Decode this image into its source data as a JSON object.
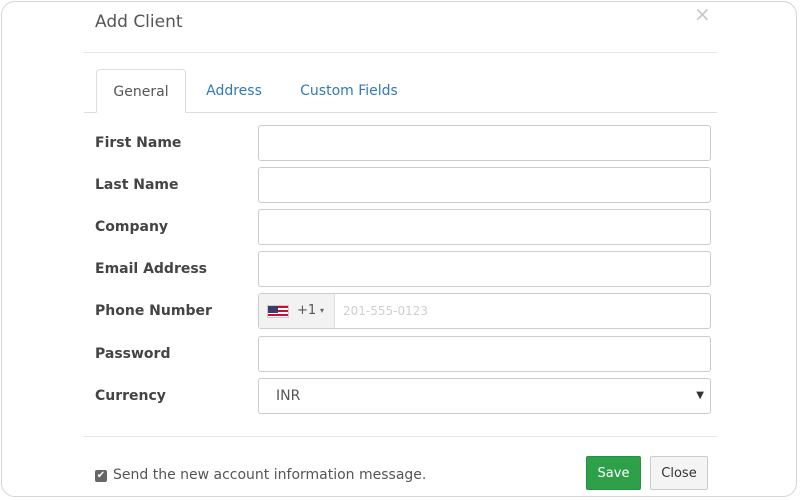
{
  "dialog": {
    "title": "Add Client",
    "close_icon": "×"
  },
  "tabs": [
    {
      "label": "General",
      "active": true
    },
    {
      "label": "Address",
      "active": false
    },
    {
      "label": "Custom Fields",
      "active": false
    }
  ],
  "form": {
    "first_name": {
      "label": "First Name",
      "value": ""
    },
    "last_name": {
      "label": "Last Name",
      "value": ""
    },
    "company": {
      "label": "Company",
      "value": ""
    },
    "email": {
      "label": "Email Address",
      "value": ""
    },
    "phone": {
      "label": "Phone Number",
      "dial_code": "+1",
      "caret": "▾",
      "placeholder": "201-555-0123",
      "flag": "us-flag-icon",
      "value": ""
    },
    "password": {
      "label": "Password",
      "value": ""
    },
    "currency": {
      "label": "Currency",
      "selected": "INR",
      "arrow": "▼"
    }
  },
  "footer": {
    "checkbox_checked": true,
    "check_mark": "✔",
    "checkbox_label": "Send the new account information message.",
    "save_label": "Save",
    "close_label": "Close"
  },
  "colors": {
    "accent_link": "#337ab7",
    "save_button": "#2ea04a"
  }
}
